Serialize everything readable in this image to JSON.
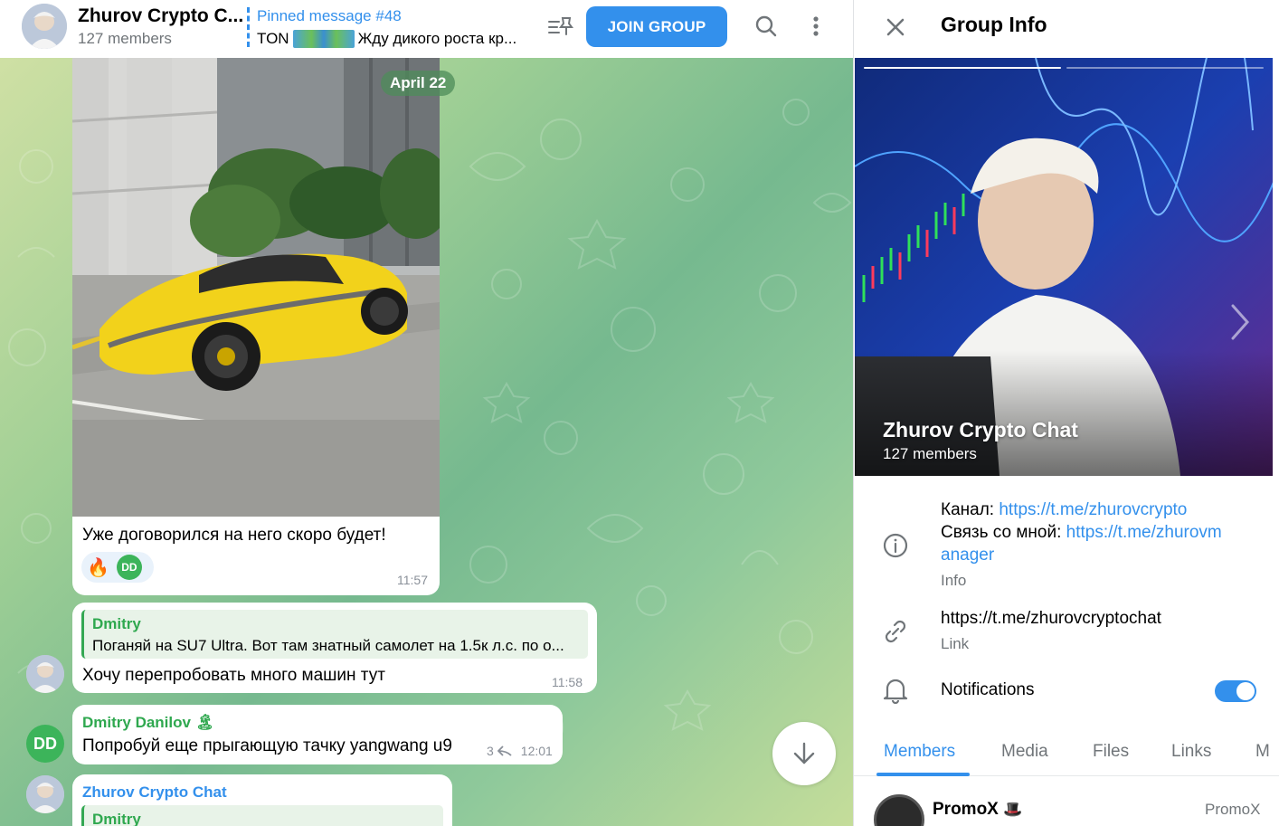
{
  "header": {
    "chat_title": "Zhurov Crypto C...",
    "members": "127 members",
    "pinned_title": "Pinned message #48",
    "pinned_prefix": "TON",
    "pinned_text": "Жду дикого роста кр...",
    "join_label": "JOIN GROUP"
  },
  "chat": {
    "date_pill": "April 22",
    "photo_message": {
      "text": "Уже договорился на него скоро будет!",
      "time": "11:57",
      "reaction_emoji": "🔥",
      "reaction_user": "DD"
    },
    "reply_message": {
      "reply_name": "Dmitry",
      "reply_text": "Поганяй на SU7 Ultra. Вот там знатный самолет на 1.5к л.с. по о...",
      "text": "Хочу перепробовать много машин тут",
      "time": "11:58"
    },
    "danilov_message": {
      "sender": "Dmitry Danilov 🏝",
      "avatar_initials": "DD",
      "text": "Попробуй еще прыгающую тачку yangwang u9",
      "replies": "3",
      "time": "12:01"
    },
    "last_message": {
      "sender": "Zhurov Crypto Chat",
      "reply_name": "Dmitry"
    }
  },
  "panel": {
    "title": "Group Info",
    "group_name": "Zhurov Crypto Chat",
    "group_members": "127 members",
    "info": {
      "channel_label": "Канал: ",
      "channel_link": "https://t.me/zhurovcrypto",
      "contact_label": "Связь со мной: ",
      "contact_link_1": "https://t.me/zhurovm",
      "contact_link_2": "anager",
      "caption": "Info"
    },
    "link": {
      "url": "https://t.me/zhurovcryptochat",
      "caption": "Link"
    },
    "notifications": {
      "label": "Notifications",
      "enabled": true
    },
    "tabs": [
      "Members",
      "Media",
      "Files",
      "Links",
      "M"
    ],
    "active_tab": "Members",
    "member": {
      "name": "PromoX",
      "role": "PromoX"
    }
  },
  "colors": {
    "accent": "#3390ec",
    "green": "#3cb45a",
    "muted": "#707579"
  }
}
